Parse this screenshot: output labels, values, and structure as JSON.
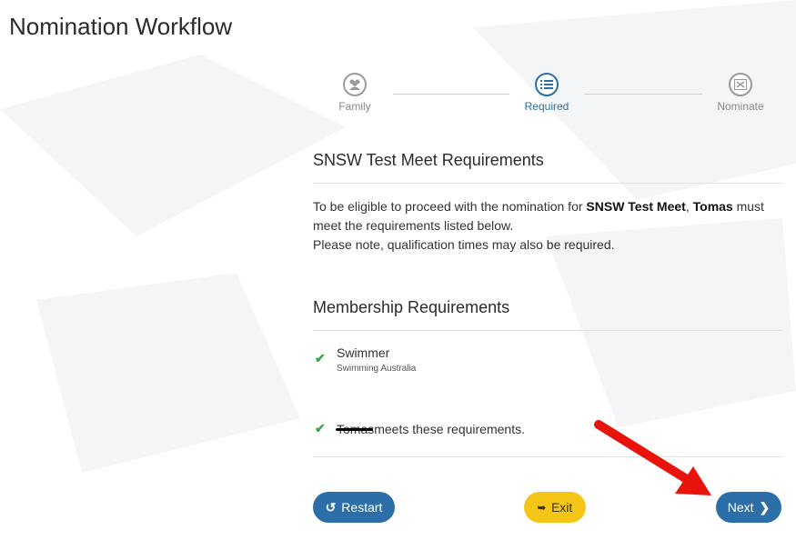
{
  "page": {
    "title": "Nomination Workflow"
  },
  "stepper": {
    "steps": [
      {
        "label": "Family",
        "icon": "users-icon",
        "state": "done"
      },
      {
        "label": "Required",
        "icon": "list-icon",
        "state": "active"
      },
      {
        "label": "Nominate",
        "icon": "flag-icon",
        "state": "pending"
      }
    ]
  },
  "requirements": {
    "heading": "SNSW Test Meet Requirements",
    "intro_prefix": "To be eligible to proceed with the nomination for ",
    "meet_name": "SNSW Test Meet",
    "intro_sep": ", ",
    "person": "Tomas",
    "intro_suffix": " must meet the requirements listed below.",
    "note": "Please note, qualification times may also be required."
  },
  "membership": {
    "heading": "Membership Requirements",
    "items": [
      {
        "name": "Swimmer",
        "organisation": "Swimming Australia"
      }
    ],
    "summary_person": "Tomas",
    "summary_text": " meets these requirements."
  },
  "buttons": {
    "restart": "Restart",
    "exit": "Exit",
    "next": "Next"
  },
  "colors": {
    "primary": "#2c6fa8",
    "warning": "#f5c518",
    "success": "#3aa54a",
    "annotation_arrow": "#e8140c"
  }
}
